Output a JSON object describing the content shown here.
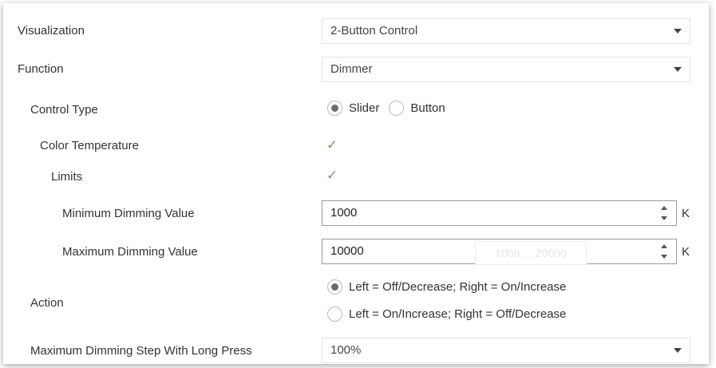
{
  "visualization": {
    "label": "Visualization",
    "value": "2-Button Control"
  },
  "function": {
    "label": "Function",
    "value": "Dimmer"
  },
  "control_type": {
    "label": "Control Type",
    "options": [
      {
        "label": "Slider",
        "checked": true
      },
      {
        "label": "Button",
        "checked": false
      }
    ]
  },
  "color_temperature": {
    "label": "Color Temperature",
    "checked": true
  },
  "limits": {
    "label": "Limits",
    "checked": true
  },
  "minimum_dimming": {
    "label": "Minimum Dimming Value",
    "value": "1000",
    "unit": "K"
  },
  "maximum_dimming": {
    "label": "Maximum Dimming Value",
    "value": "10000",
    "unit": "K",
    "tooltip": "1000 ... 20000"
  },
  "action": {
    "label": "Action",
    "options": [
      {
        "label": "Left = Off/Decrease; Right = On/Increase",
        "checked": true
      },
      {
        "label": "Left = On/Increase; Right = Off/Decrease",
        "checked": false
      }
    ]
  },
  "max_dimming_step": {
    "label": "Maximum Dimming Step With Long Press",
    "value": "100%"
  },
  "icons": {
    "check": "✓",
    "dropdown": "chevron-down-icon",
    "spinner": "spinner-icon"
  },
  "colors": {
    "check": "#6aa84f",
    "border": "#9a9a9a"
  }
}
